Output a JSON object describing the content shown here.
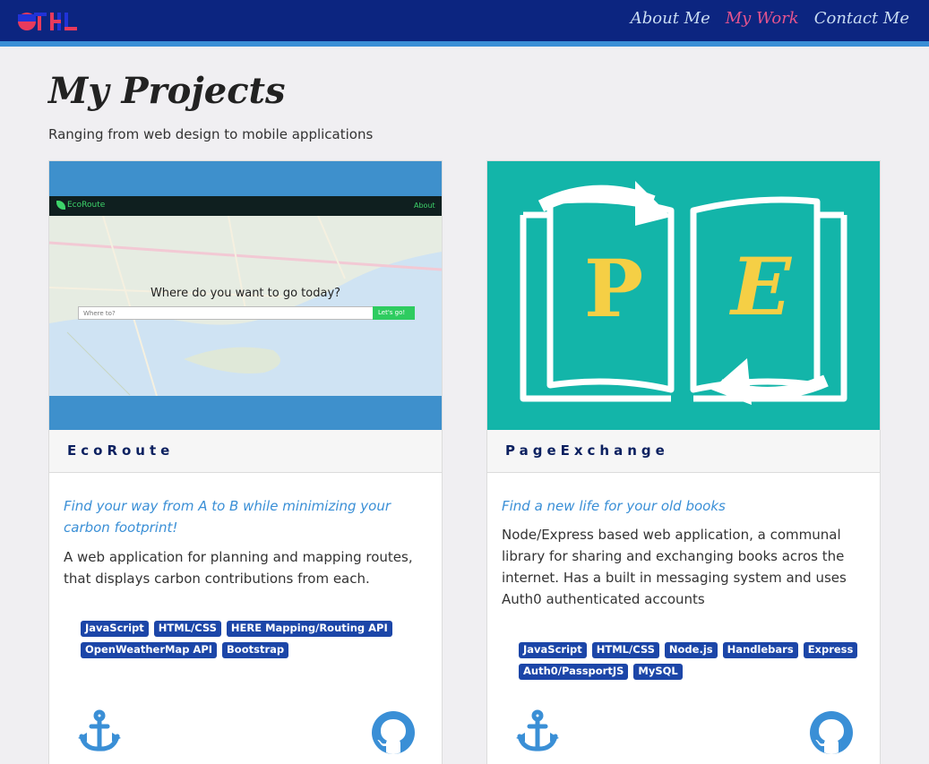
{
  "nav": {
    "links": [
      {
        "label": "About Me",
        "active": false
      },
      {
        "label": "My Work",
        "active": true
      },
      {
        "label": "Contact Me",
        "active": false
      }
    ]
  },
  "header": {
    "title": "My Projects",
    "subtitle": "Ranging from web design to mobile applications"
  },
  "projects": [
    {
      "name": "EcoRoute",
      "tagline": "Find your way from A to B while minimizing your carbon footprint!",
      "description": "A web application for planning and mapping routes, that displays carbon contributions from each.",
      "tags": [
        "JavaScript",
        "HTML/CSS",
        "HERE Mapping/Routing API",
        "OpenWeatherMap API",
        "Bootstrap"
      ],
      "screenshot": {
        "brand": "EcoRoute",
        "nav_link": "About",
        "heading": "Where do you want to go today?",
        "input_placeholder": "Where to?",
        "button_label": "Let's go!"
      }
    },
    {
      "name": "PageExchange",
      "tagline": "Find a new life for your old books",
      "description": "Node/Express based web application, a communal library for sharing and exchanging books acros the internet. Has a built in messaging system and uses Auth0 authenticated accounts",
      "tags": [
        "JavaScript",
        "HTML/CSS",
        "Node.js",
        "Handlebars",
        "Express",
        "Auth0/PassportJS",
        "MySQL"
      ],
      "logo": {
        "left_letter": "P",
        "right_letter": "E"
      }
    }
  ],
  "colors": {
    "navbar": "#0c2580",
    "nav_accent": "#e5548e",
    "tag": "#1c46a8",
    "icon": "#3a8fd6",
    "teal": "#13b5a9"
  },
  "icons": {
    "card_left": "anchor-icon",
    "card_right": "github-icon"
  }
}
